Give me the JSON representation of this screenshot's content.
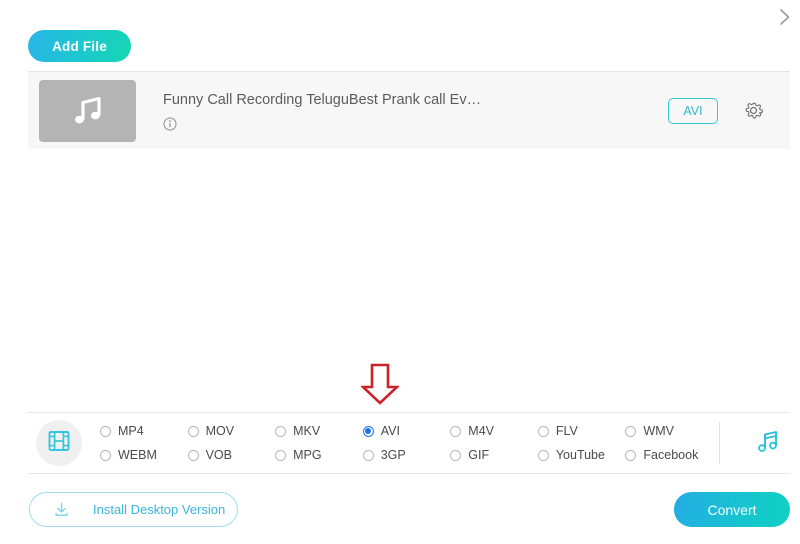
{
  "header": {
    "chevron_icon": "chevron-right-icon",
    "add_file_label": "Add File"
  },
  "file_list": {
    "items": [
      {
        "thumbnail_icon": "music-note-icon",
        "name": "Funny Call Recording TeluguBest Prank call Ev…",
        "info_icon": "info-circle-icon",
        "output_format": "AVI",
        "settings_icon": "gear-icon"
      }
    ]
  },
  "annotation": {
    "arrow_icon": "arrow-down-icon",
    "color": "#cc2229"
  },
  "format_bar": {
    "video_tab_icon": "film-strip-icon",
    "audio_tab_icon": "music-note-icon",
    "selected": "AVI",
    "options": [
      "MP4",
      "MOV",
      "MKV",
      "AVI",
      "M4V",
      "FLV",
      "WMV",
      "WEBM",
      "VOB",
      "MPG",
      "3GP",
      "GIF",
      "YouTube",
      "Facebook"
    ]
  },
  "footer": {
    "install_label": "Install Desktop Version",
    "install_icon": "download-icon",
    "convert_label": "Convert"
  },
  "colors": {
    "accent_cyan": "#29b6e8",
    "accent_teal": "#17d6b4",
    "radio_selected": "#1a73e8",
    "annotation_red": "#cc2229",
    "row_bg": "#f7f7f7"
  }
}
